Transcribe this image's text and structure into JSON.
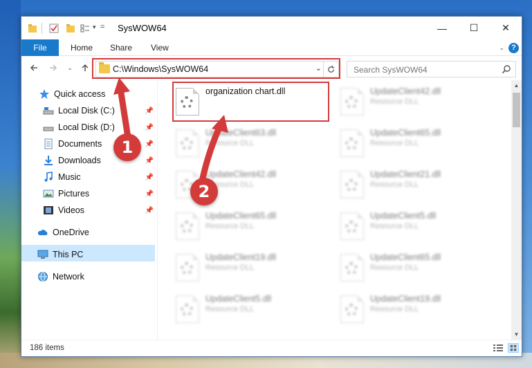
{
  "window": {
    "title": "SysWOW64"
  },
  "ribbon": {
    "tabs": [
      "File",
      "Home",
      "Share",
      "View"
    ]
  },
  "address": {
    "path": "C:\\Windows\\SysWOW64",
    "search_placeholder": "Search SysWOW64"
  },
  "sidebar": {
    "items": [
      {
        "label": "Quick access",
        "icon": "star-icon",
        "pinned": false
      },
      {
        "label": "Local Disk (C:)",
        "icon": "drive-icon",
        "pinned": true
      },
      {
        "label": "Local Disk (D:)",
        "icon": "drive-icon",
        "pinned": true
      },
      {
        "label": "Documents",
        "icon": "documents-icon",
        "pinned": true
      },
      {
        "label": "Downloads",
        "icon": "downloads-icon",
        "pinned": true
      },
      {
        "label": "Music",
        "icon": "music-icon",
        "pinned": true
      },
      {
        "label": "Pictures",
        "icon": "pictures-icon",
        "pinned": true
      },
      {
        "label": "Videos",
        "icon": "videos-icon",
        "pinned": true
      },
      {
        "label": "OneDrive",
        "icon": "onedrive-icon",
        "pinned": false
      },
      {
        "label": "This PC",
        "icon": "this-pc-icon",
        "pinned": false,
        "selected": true
      },
      {
        "label": "Network",
        "icon": "network-icon",
        "pinned": false
      }
    ]
  },
  "files": [
    {
      "name": "organization chart.dll",
      "type": ""
    },
    {
      "name": "UpdateClient42.dll",
      "type": "Resource DLL"
    },
    {
      "name": "UpdateClient63.dll",
      "type": "Resource DLL"
    },
    {
      "name": "UpdateClient65.dll",
      "type": "Resource DLL"
    },
    {
      "name": "UpdateClient42.dll",
      "type": "Resource DLL"
    },
    {
      "name": "UpdateClient21.dll",
      "type": "Resource DLL"
    },
    {
      "name": "UpdateClient65.dll",
      "type": "Resource DLL"
    },
    {
      "name": "UpdateClient5.dll",
      "type": "Resource DLL"
    },
    {
      "name": "UpdateClient19.dll",
      "type": "Resource DLL"
    },
    {
      "name": "UpdateClient65.dll",
      "type": "Resource DLL"
    },
    {
      "name": "UpdateClient5.dll",
      "type": "Resource DLL"
    },
    {
      "name": "UpdateClient19.dll",
      "type": "Resource DLL"
    }
  ],
  "status": {
    "item_count": "186 items"
  },
  "annotations": {
    "step1": "1",
    "step2": "2",
    "color": "#d33a3a"
  },
  "colors": {
    "accent": "#1979ca",
    "selection": "#cce8ff",
    "folder": "#f3c74b"
  }
}
